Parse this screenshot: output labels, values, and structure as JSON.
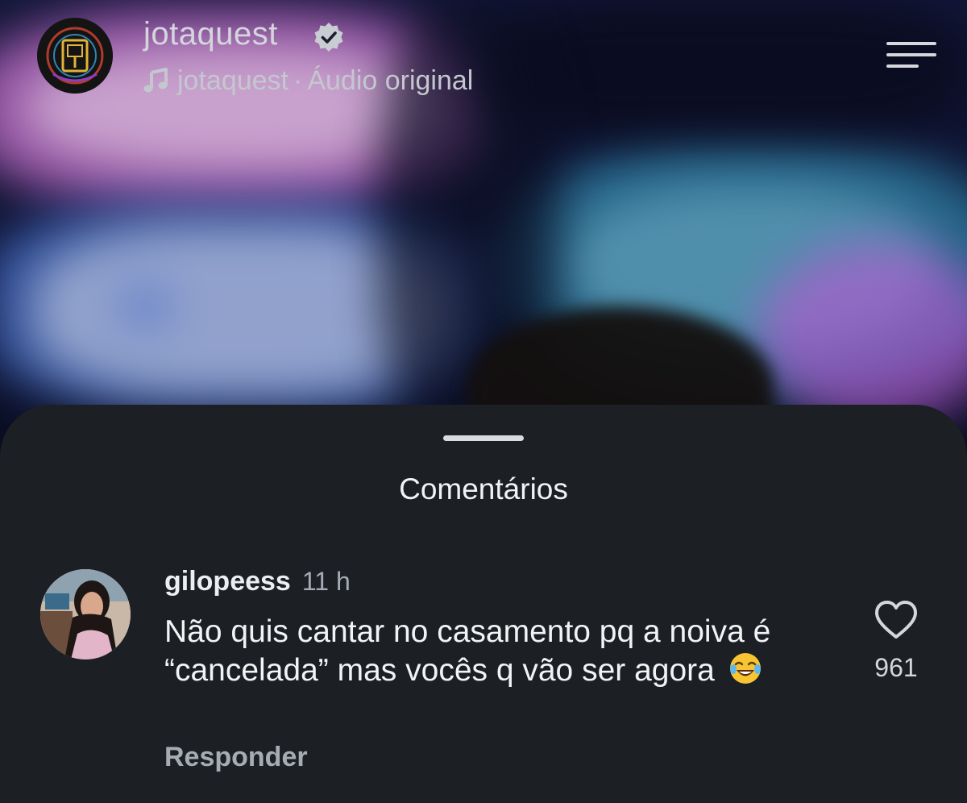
{
  "header": {
    "username": "jotaquest",
    "audio_artist": "jotaquest",
    "audio_separator": "·",
    "audio_label": "Áudio original",
    "verified_icon": "verified-badge-icon",
    "menu_icon": "menu-lines-icon"
  },
  "sheet": {
    "title": "Comentários"
  },
  "comment": {
    "username": "gilopeess",
    "time": "11 h",
    "text": "Não quis cantar no casamento pq a noiva é “cancelada” mas vocês q vão ser agora",
    "emoji": "face-with-tears-of-joy-icon",
    "reply_label": "Responder",
    "like_count": "961",
    "like_icon": "heart-outline-icon"
  },
  "colors": {
    "sheet_bg": "#1c1f24",
    "primary_text": "#f2f3f5",
    "secondary_text": "#a7abb3"
  }
}
